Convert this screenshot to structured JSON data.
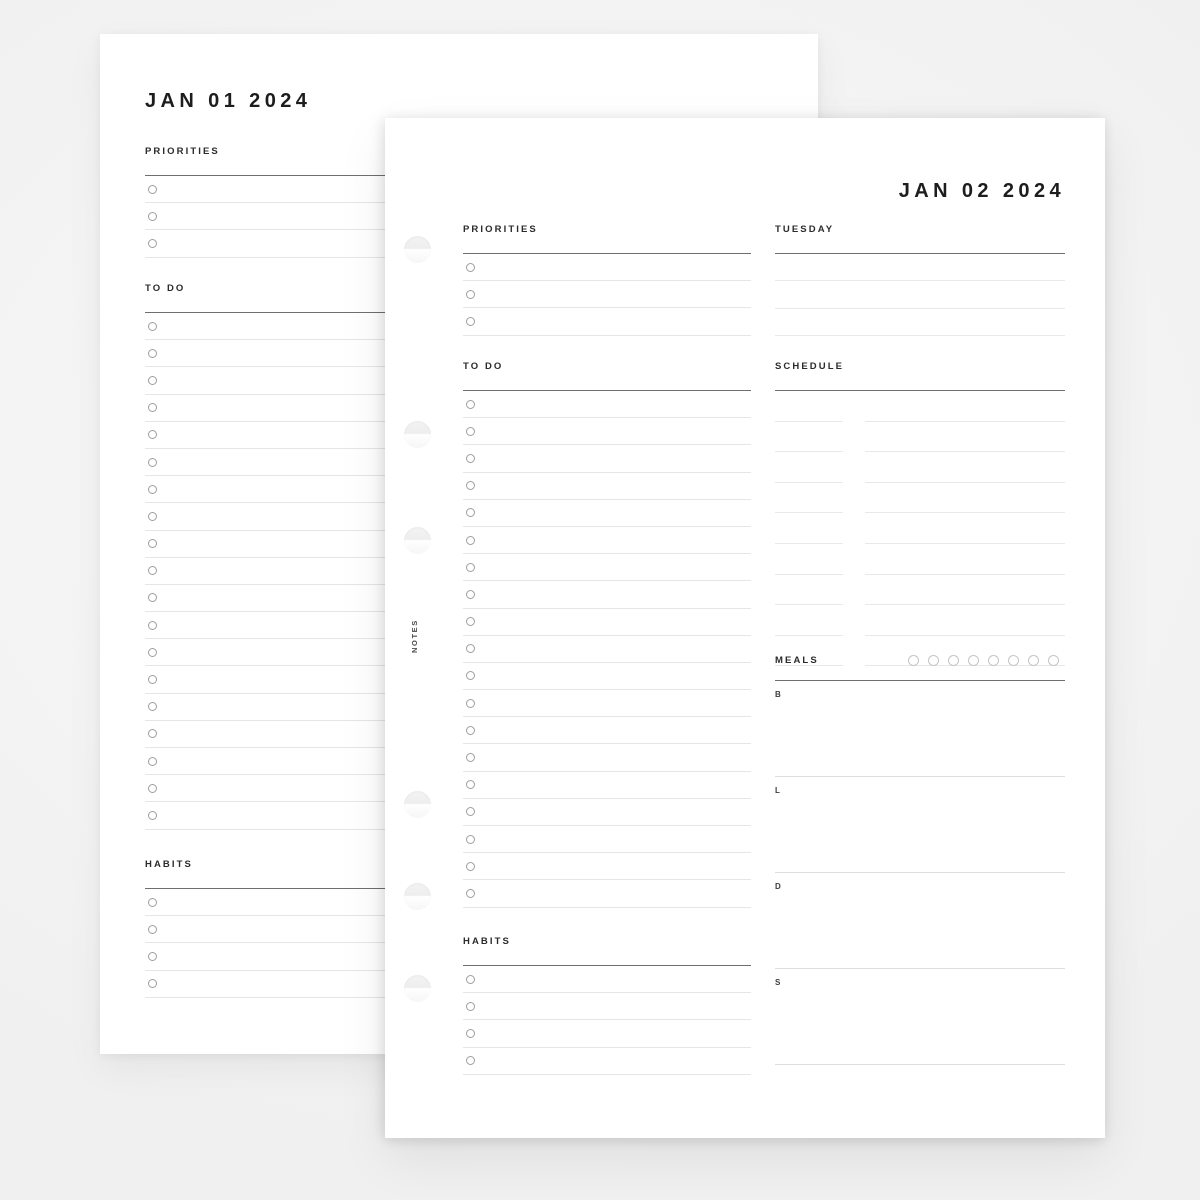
{
  "background": {
    "color": "#f4f4f4"
  },
  "colors": {
    "page": "#ffffff",
    "heading_text": "#1d1d1d",
    "label_text": "#2b2b2b",
    "rule_strong": "#6f6f6f",
    "rule_light": "#e3e3e3",
    "circle_border": "#9e9e9e"
  },
  "back_page": {
    "title": "JAN 01 2024",
    "sections": [
      {
        "label": "PRIORITIES",
        "type": "checklist",
        "rows": 3
      },
      {
        "label": "TO DO",
        "type": "checklist",
        "rows": 19
      },
      {
        "label": "HABITS",
        "type": "checklist",
        "rows": 4
      }
    ]
  },
  "front_page": {
    "title": "JAN 02 2024",
    "margin_label": "NOTES",
    "binder_holes": 6,
    "left_column": {
      "sections": [
        {
          "label": "PRIORITIES",
          "type": "checklist",
          "rows": 3
        },
        {
          "label": "TO DO",
          "type": "checklist",
          "rows": 19
        },
        {
          "label": "HABITS",
          "type": "checklist",
          "rows": 4
        }
      ]
    },
    "right_column": {
      "sections": [
        {
          "label": "TUESDAY",
          "type": "lines",
          "rows": 3
        },
        {
          "label": "SCHEDULE",
          "type": "schedule",
          "rows": 9
        },
        {
          "label": "MEALS",
          "type": "meals",
          "tracker_circles": 8,
          "blocks": [
            "B",
            "L",
            "D",
            "S"
          ]
        }
      ]
    }
  }
}
